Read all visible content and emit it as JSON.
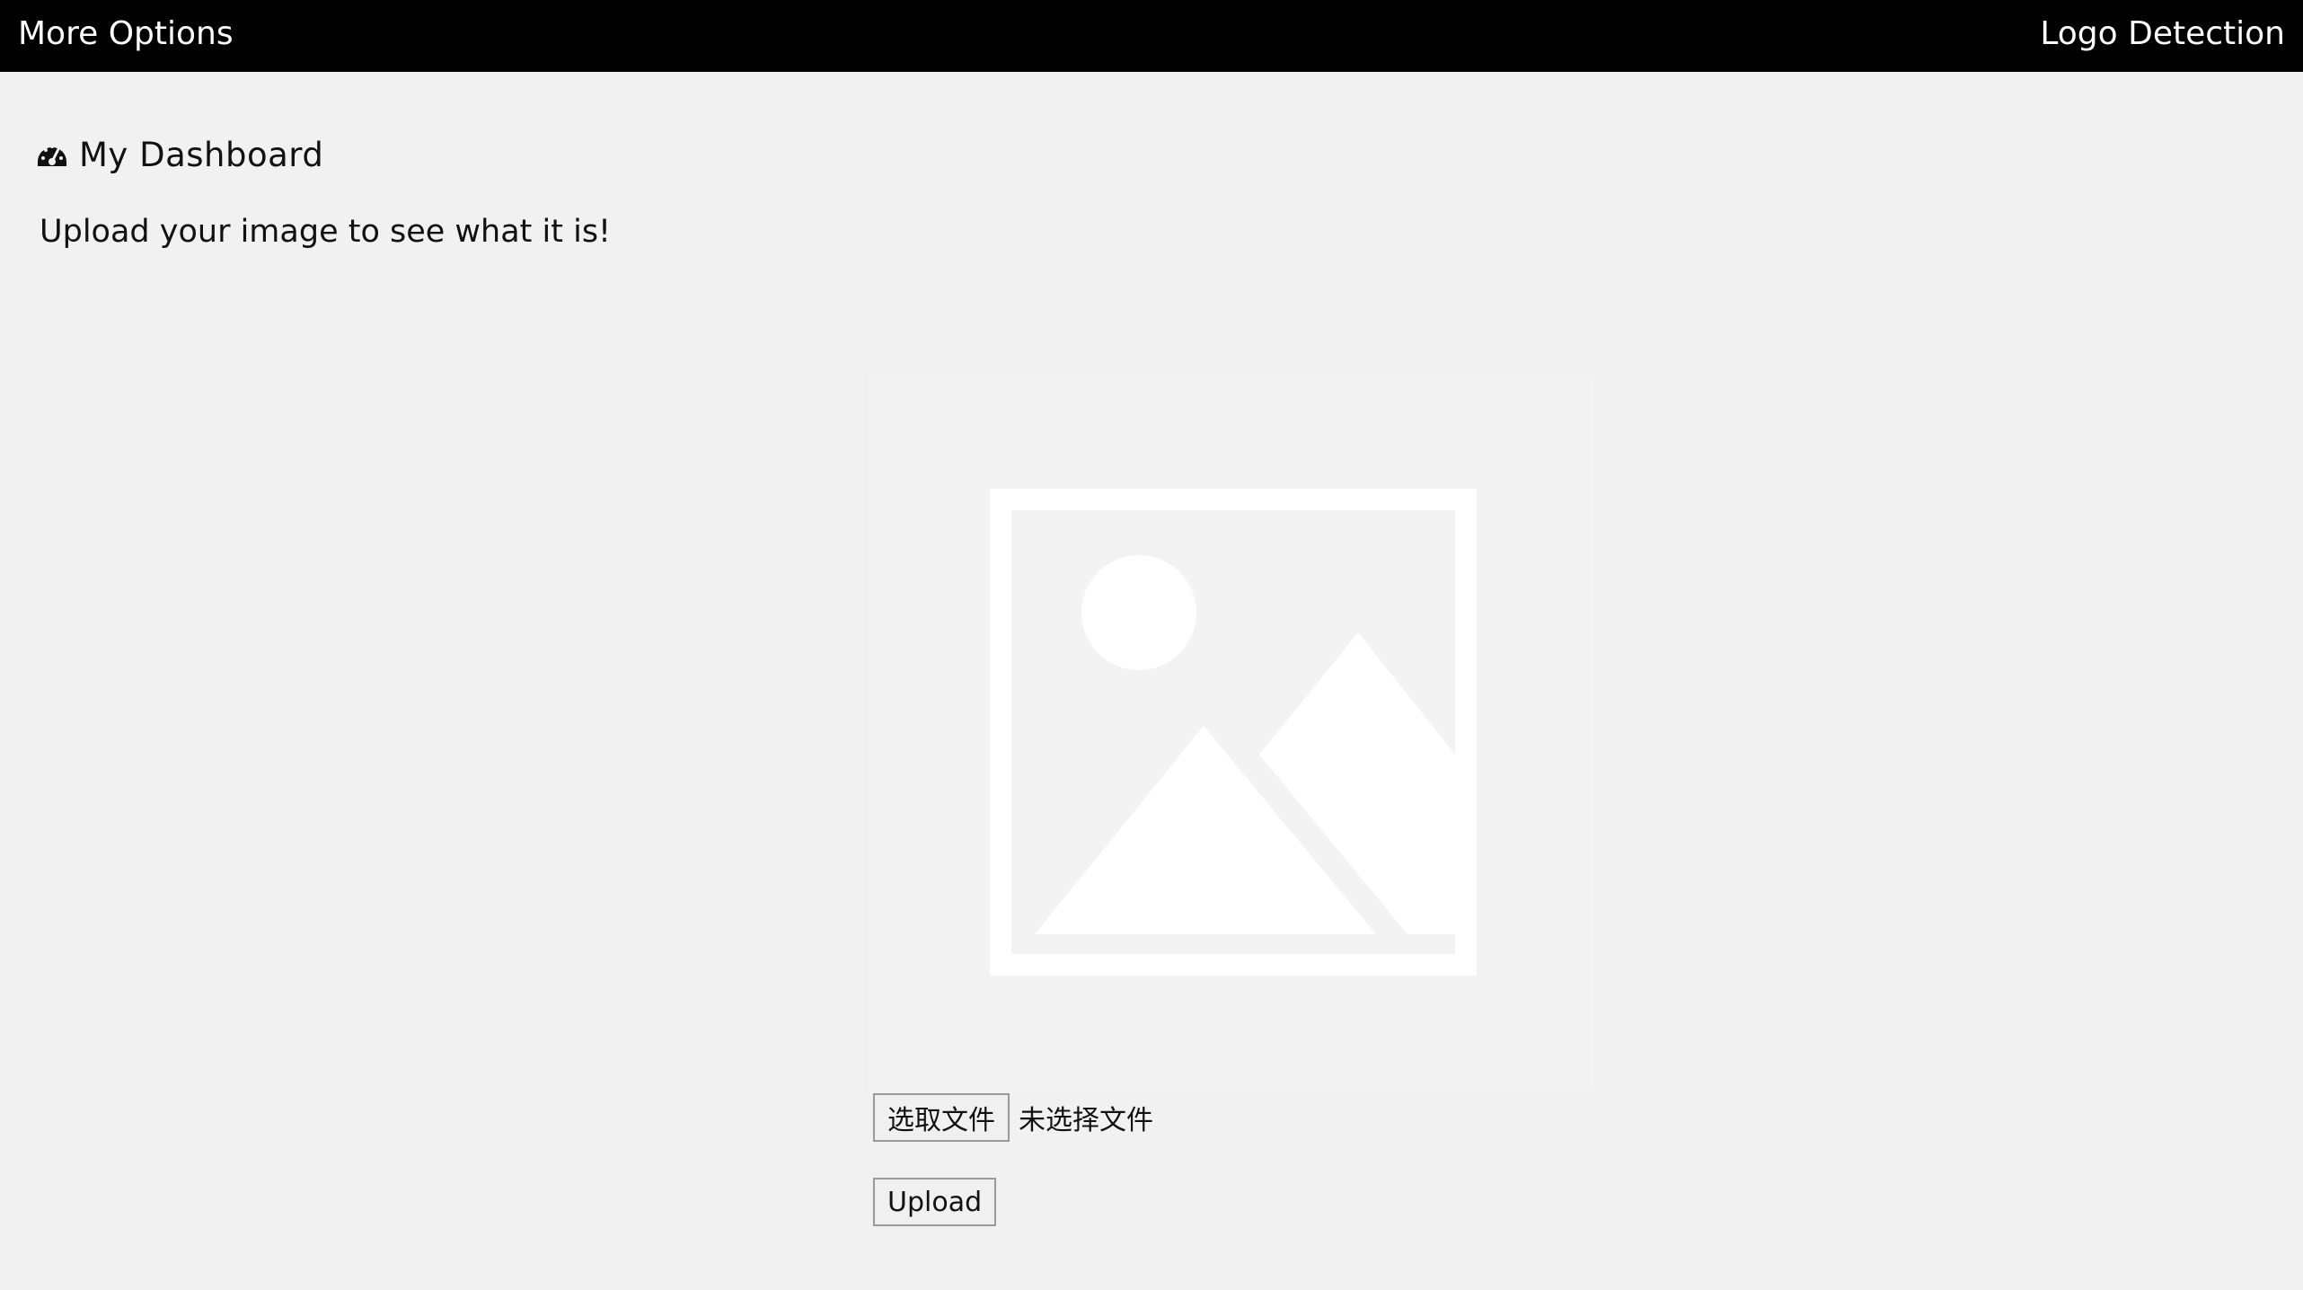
{
  "topbar": {
    "more_options": "More Options",
    "app_title": "Logo Detection"
  },
  "dashboard": {
    "icon": "tachometer-icon",
    "title": "My Dashboard",
    "subtitle": "Upload your image to see what it is!"
  },
  "preview": {
    "icon": "image-placeholder-icon"
  },
  "file_input": {
    "choose_label": "选取文件",
    "status": "未选择文件"
  },
  "upload": {
    "label": "Upload"
  },
  "colors": {
    "topbar_bg": "#000000",
    "page_bg": "#f1f1f1",
    "placeholder": "#ffffff"
  }
}
